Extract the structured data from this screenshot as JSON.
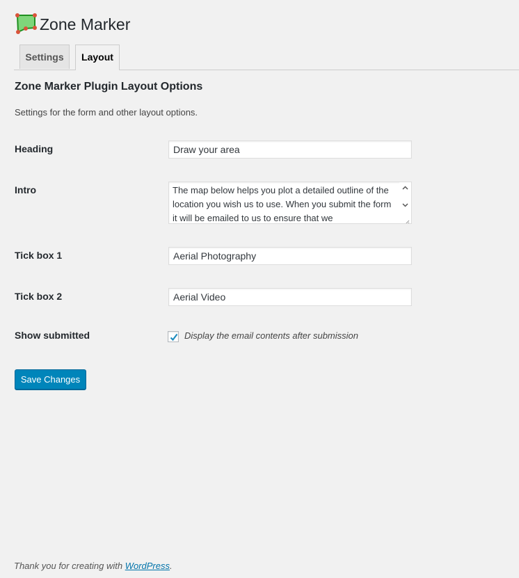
{
  "header": {
    "title": "Zone Marker",
    "logo_icon": "zone-marker-polygon-icon"
  },
  "tabs": [
    {
      "label": "Settings",
      "active": false
    },
    {
      "label": "Layout",
      "active": true
    }
  ],
  "section": {
    "title": "Zone Marker Plugin Layout Options",
    "description": "Settings for the form and other layout options."
  },
  "fields": {
    "heading": {
      "label": "Heading",
      "value": "Draw your area"
    },
    "intro": {
      "label": "Intro",
      "value": "The map below helps you plot a detailed outline of the location you wish us to use. When you submit the form it will be emailed to us to ensure that we"
    },
    "tick_box_1": {
      "label": "Tick box 1",
      "value": "Aerial Photography"
    },
    "tick_box_2": {
      "label": "Tick box 2",
      "value": "Aerial Video"
    },
    "show_submitted": {
      "label": "Show submitted",
      "checked": true,
      "checkbox_label": "Display the email contents after submission"
    }
  },
  "actions": {
    "save_label": "Save Changes"
  },
  "footer": {
    "text": "Thank you for creating with ",
    "link_text": "WordPress",
    "suffix": "."
  },
  "colors": {
    "primary_button": "#0085ba",
    "link": "#0073aa",
    "background": "#f1f1f1"
  }
}
